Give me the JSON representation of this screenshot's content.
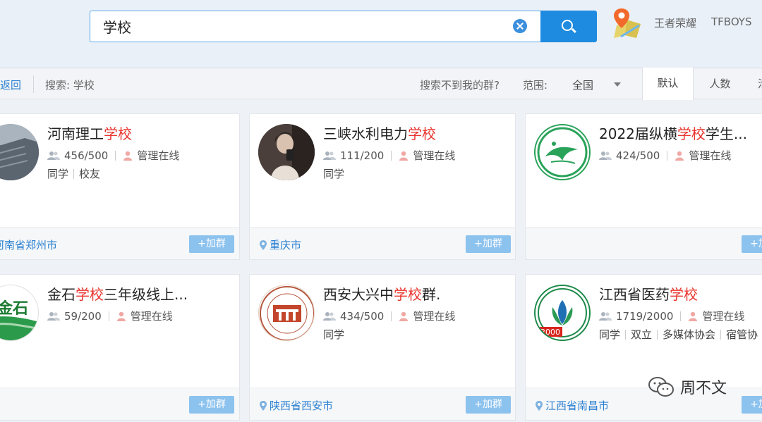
{
  "search": {
    "query": "学校"
  },
  "header_links": [
    "王者荣耀",
    "TFBOYS"
  ],
  "toolbar": {
    "back": "返回",
    "search_label": "搜索: 学校",
    "not_found": "搜索不到我的群?",
    "scope_label": "范围:",
    "scope_value": "全国",
    "sort_tabs": [
      "默认",
      "人数",
      "活"
    ]
  },
  "join_label": "+加群",
  "stat_admin": "管理在线",
  "cards": [
    {
      "name_prefix": "河南理工",
      "name_highlight": "学校",
      "name_suffix": "",
      "members": "456/500",
      "tags": [
        "同学",
        "校友"
      ],
      "location": "河南省郑州市"
    },
    {
      "name_prefix": "三峡水利电力",
      "name_highlight": "学校",
      "name_suffix": "",
      "members": "111/200",
      "tags": [
        "同学"
      ],
      "location": "重庆市"
    },
    {
      "name_prefix": "2022届纵横",
      "name_highlight": "学校",
      "name_suffix": "学生...",
      "members": "424/500",
      "tags": [],
      "location": ""
    },
    {
      "name_prefix": "金石",
      "name_highlight": "学校",
      "name_suffix": "三年级线上...",
      "members": "59/200",
      "tags": [],
      "location": ""
    },
    {
      "name_prefix": "西安大兴中",
      "name_highlight": "学校",
      "name_suffix": "群.",
      "members": "434/500",
      "tags": [
        "同学"
      ],
      "location": "陕西省西安市"
    },
    {
      "name_prefix": "江西省医药",
      "name_highlight": "学校",
      "name_suffix": "",
      "members": "1719/2000",
      "tags": [
        "同学",
        "双立",
        "多媒体协会",
        "宿管协"
      ],
      "location": "江西省南昌市"
    }
  ],
  "avatar_text": {
    "jinshi": "金石",
    "jiangxi_year": "2000"
  },
  "watermark": "周不文",
  "colors": {
    "accent": "#1e8be0",
    "highlight": "#e8352e",
    "link": "#2a7fd0",
    "join_button": "#8cc2ee"
  }
}
